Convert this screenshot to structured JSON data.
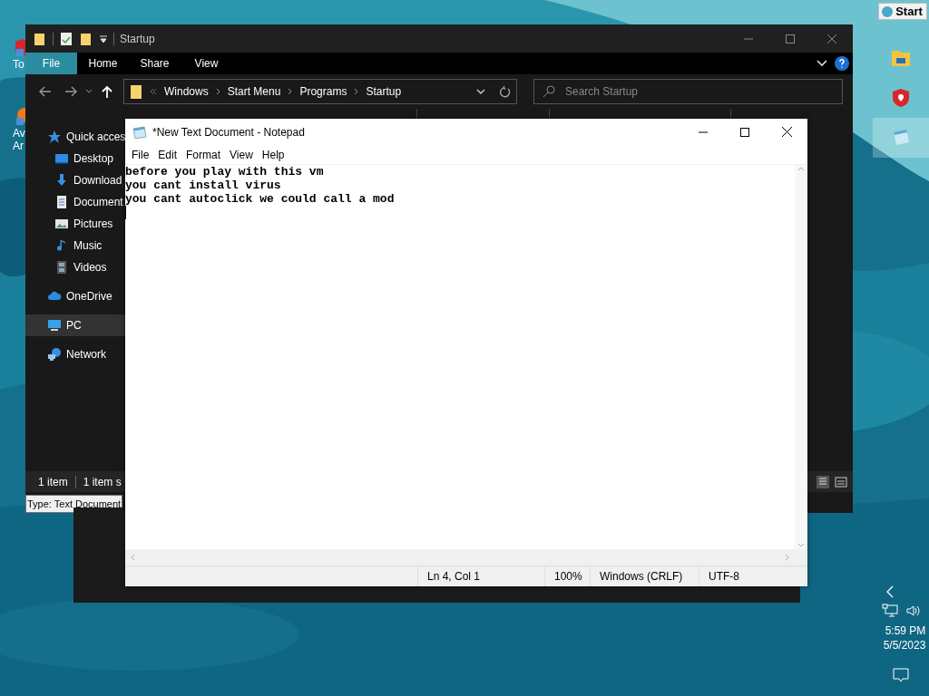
{
  "desktop": {
    "icons": [
      {
        "lines": [
          "To"
        ]
      },
      {
        "lines": [
          "Av",
          "Ar"
        ]
      }
    ]
  },
  "taskbar": {
    "start_button": "Start",
    "pinned": [
      {
        "kind": "folder",
        "selected": false
      },
      {
        "kind": "shield",
        "selected": false
      },
      {
        "kind": "notepad",
        "selected": true
      }
    ],
    "time": "5:59 PM",
    "date": "5/5/2023"
  },
  "explorer": {
    "title": "Startup",
    "ribbon_tabs": [
      {
        "label": "File",
        "selected": true
      },
      {
        "label": "Home",
        "selected": false
      },
      {
        "label": "Share",
        "selected": false
      },
      {
        "label": "View",
        "selected": false
      }
    ],
    "breadcrumbs": [
      "Windows",
      "Start Menu",
      "Programs",
      "Startup"
    ],
    "search": {
      "placeholder": "Search Startup"
    },
    "nav": [
      {
        "label": "Quick acces",
        "kind": "star",
        "selected": false,
        "children": [
          {
            "label": "Desktop",
            "kind": "desktop",
            "selected": false
          },
          {
            "label": "Download",
            "kind": "download",
            "selected": false
          },
          {
            "label": "Document",
            "kind": "document",
            "selected": false
          },
          {
            "label": "Pictures",
            "kind": "pictures",
            "selected": false
          },
          {
            "label": "Music",
            "kind": "music",
            "selected": false
          },
          {
            "label": "Videos",
            "kind": "videos",
            "selected": false
          }
        ]
      },
      {
        "label": "OneDrive",
        "kind": "cloud",
        "selected": false
      },
      {
        "label": "PC",
        "kind": "pc",
        "selected": true
      },
      {
        "label": "Network",
        "kind": "network",
        "selected": false
      }
    ],
    "status_bar": [
      "1 item",
      "1 item s"
    ],
    "tooltip": "Type: Text Document"
  },
  "notepad": {
    "title": "*New Text Document - Notepad",
    "menu": [
      "File",
      "Edit",
      "Format",
      "View",
      "Help"
    ],
    "lines": [
      "before you play with this vm",
      "you cant install virus",
      "you cant autoclick we could call a mod"
    ],
    "status_bar": {
      "position": "Ln 4, Col 1",
      "zoom": "100%",
      "line_ending": "Windows (CRLF)",
      "encoding": "UTF-8"
    }
  }
}
